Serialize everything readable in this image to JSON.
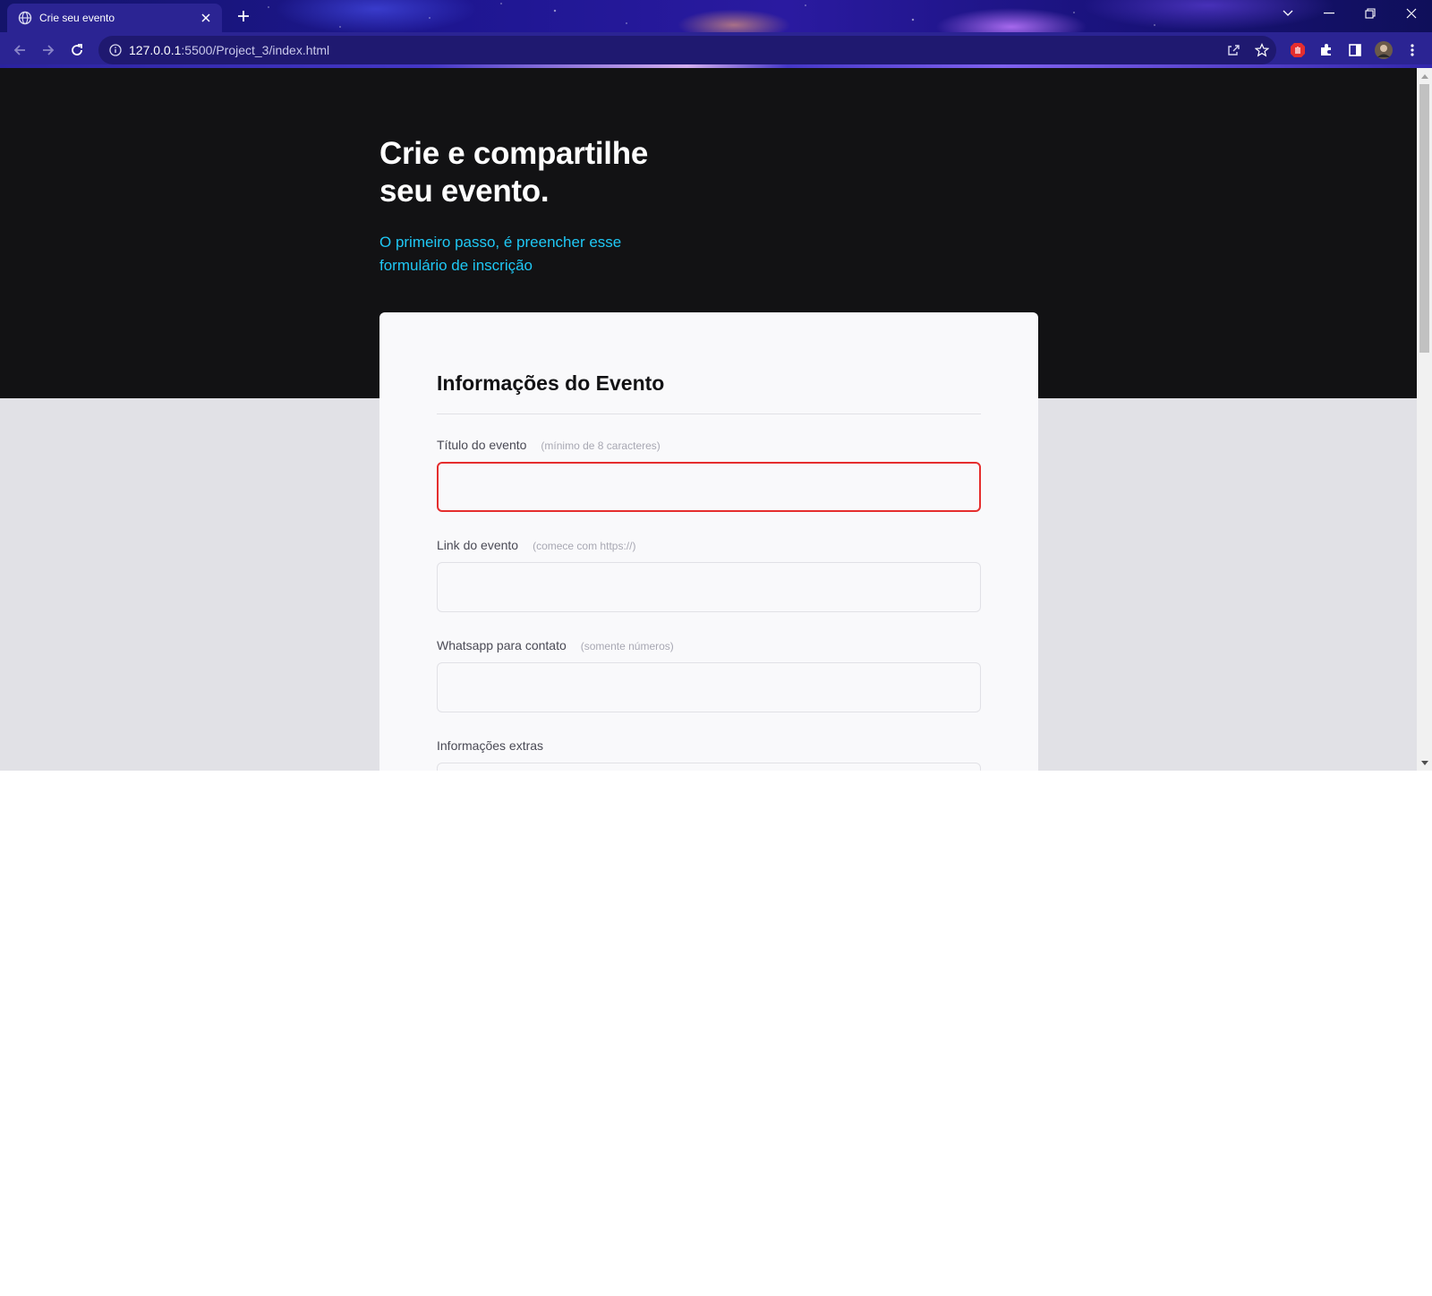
{
  "browser": {
    "tab_title": "Crie seu evento",
    "url_host": "127.0.0.1",
    "url_rest": ":5500/Project_3/index.html"
  },
  "hero": {
    "title": "Crie e compartilhe seu evento.",
    "subtitle": "O primeiro passo, é preencher esse formulário de inscrição"
  },
  "form": {
    "heading": "Informações do Evento",
    "fields": [
      {
        "label": "Título do evento",
        "hint": "(mínimo de 8 caracteres)",
        "value": "",
        "state": "invalid"
      },
      {
        "label": "Link do evento",
        "hint": "(comece com https://)",
        "value": "",
        "state": "default"
      },
      {
        "label": "Whatsapp para contato",
        "hint": "(somente números)",
        "value": "",
        "state": "default"
      },
      {
        "label": "Informações extras",
        "hint": "",
        "value": "",
        "state": "default"
      }
    ]
  },
  "icons": {
    "tab_favicon": "globe-icon",
    "tab_close": "close-icon",
    "new_tab": "plus-icon",
    "back": "back-arrow-icon",
    "forward": "forward-arrow-icon",
    "reload": "reload-icon",
    "site_info": "info-icon",
    "share": "share-icon",
    "bookmark": "star-icon",
    "extension_blocker": "stop-hand-icon",
    "extensions": "puzzle-icon",
    "side_panel": "side-panel-icon",
    "profile": "avatar",
    "menu": "kebab-menu-icon"
  },
  "colors": {
    "hero_bg": "#121214",
    "accent_cyan": "#1fc8f5",
    "page_bg": "#e1e1e6",
    "card_bg": "#f9f9fb",
    "error": "#e52e2e"
  }
}
